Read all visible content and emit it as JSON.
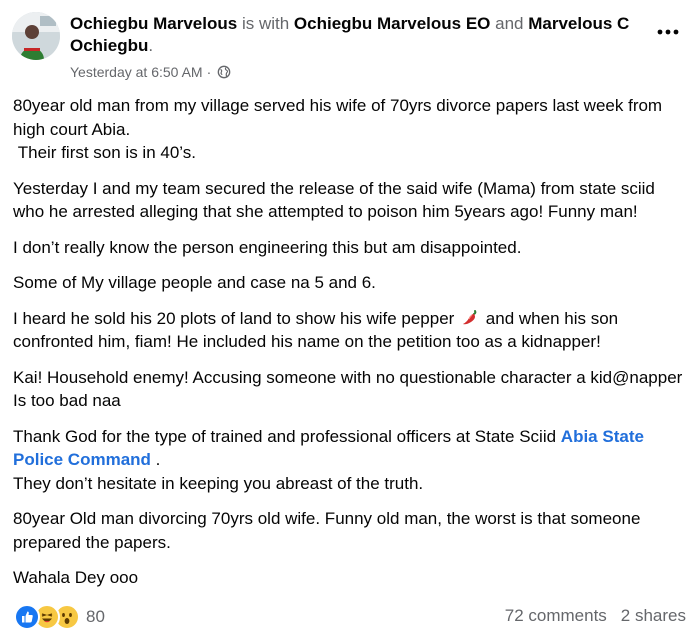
{
  "post": {
    "author": "Ochiegbu Marvelous",
    "with_text": "is with",
    "tagged_1": "Ochiegbu Marvelous EO",
    "and_text": "and",
    "tagged_2": "Marvelous C Ochiegbu",
    "end_punct": ".",
    "timestamp": "Yesterday at 6:50 AM",
    "separator": "·",
    "privacy_icon": "globe-icon",
    "more_icon": "more-options-icon"
  },
  "content": {
    "p1a": "80year old man from my village served his wife of 70yrs divorce papers last week from high court Abia.",
    "p1b": "Their first son is in 40’s.",
    "p2": "Yesterday I and my team secured the release of the said wife (Mama) from state sciid who he arrested alleging that she attempted to poison him 5years ago! Funny man!",
    "p3": "I don’t really know the person engineering this but am disappointed.",
    "p4": "Some of My village people and case na 5 and 6.",
    "p5a": "I heard he sold his 20 plots of land to show his wife pepper",
    "p5b": "and when his son confronted him, fiam! He included his name on the petition too as a kidnapper!",
    "p6": "Kai! Household enemy! Accusing someone with no questionable character  a kid@napper Is too bad naa",
    "p7a": "Thank God for the type of trained and professional officers at State Sciid",
    "p7_link": "Abia State Police Command",
    "p7b": ".",
    "p7c": "They don’t hesitate in keeping you abreast of the truth.",
    "p8": "80year Old man divorcing 70yrs old wife. Funny old man, the worst is that someone prepared the  papers.",
    "p9": "Wahala Dey ooo",
    "emoji_icon": "chili-pepper-icon"
  },
  "footer": {
    "reaction_icons": [
      "like-icon",
      "haha-icon",
      "wow-icon"
    ],
    "reaction_count": "80",
    "comments": "72 comments",
    "shares": "2 shares"
  },
  "colors": {
    "link": "#216fdb",
    "muted": "#65676b",
    "text": "#050505",
    "like_blue": "#1877f2",
    "emoji_yellow": "#f7c843"
  }
}
